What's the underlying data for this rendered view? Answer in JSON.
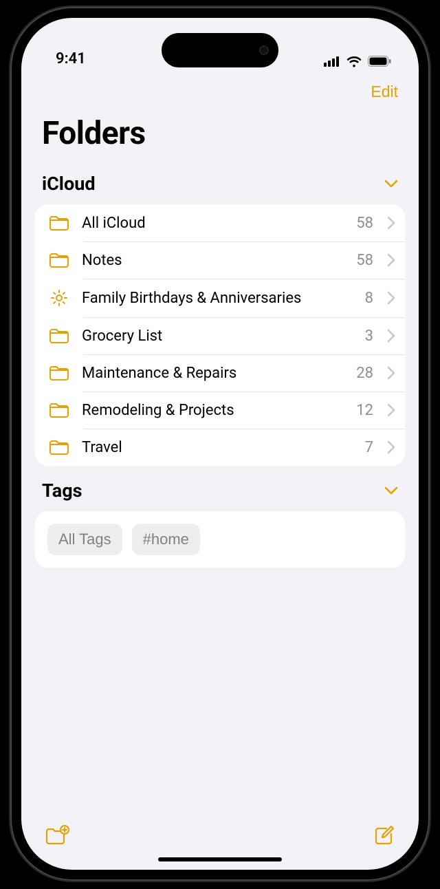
{
  "status": {
    "time": "9:41"
  },
  "nav": {
    "edit": "Edit"
  },
  "title": "Folders",
  "sections": {
    "icloud": {
      "header": "iCloud",
      "rows": [
        {
          "icon": "folder",
          "label": "All iCloud",
          "count": "58"
        },
        {
          "icon": "folder",
          "label": "Notes",
          "count": "58"
        },
        {
          "icon": "gear",
          "label": "Family Birthdays & Anniversaries",
          "count": "8"
        },
        {
          "icon": "folder",
          "label": "Grocery List",
          "count": "3"
        },
        {
          "icon": "folder",
          "label": "Maintenance & Repairs",
          "count": "28"
        },
        {
          "icon": "folder",
          "label": "Remodeling & Projects",
          "count": "12"
        },
        {
          "icon": "folder",
          "label": "Travel",
          "count": "7"
        }
      ]
    },
    "tags": {
      "header": "Tags",
      "chips": [
        "All Tags",
        "#home"
      ]
    }
  }
}
